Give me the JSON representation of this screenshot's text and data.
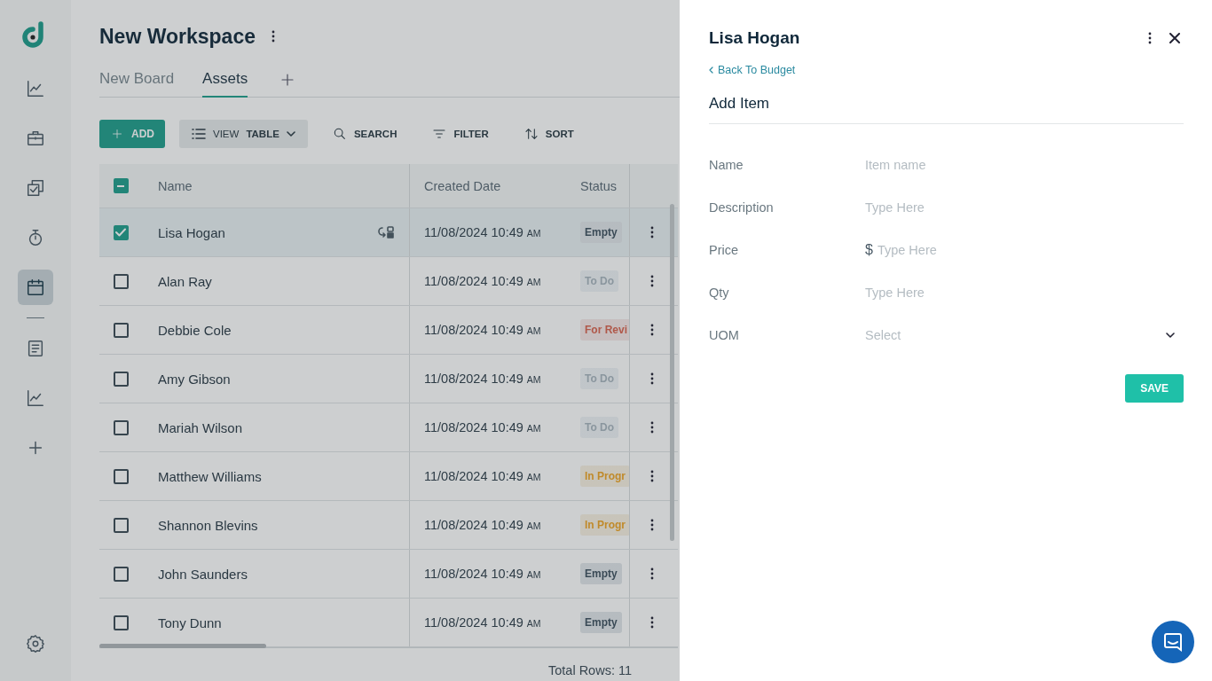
{
  "sidebar": {
    "items": [
      {
        "kind": "chart",
        "selected": false
      },
      {
        "kind": "briefcase",
        "selected": false
      },
      {
        "kind": "tasks",
        "selected": false
      },
      {
        "kind": "timer",
        "selected": false
      },
      {
        "kind": "calendar",
        "selected": true
      },
      {
        "kind": "divider"
      },
      {
        "kind": "document",
        "selected": false
      },
      {
        "kind": "chart",
        "selected": false
      },
      {
        "kind": "plus",
        "selected": false
      }
    ]
  },
  "workspace": {
    "title": "New Workspace"
  },
  "tabs": [
    {
      "label": "New Board",
      "selected": false
    },
    {
      "label": "Assets",
      "selected": true
    }
  ],
  "toolbar": {
    "add": "ADD",
    "view_prefix": "VIEW",
    "view_value": "TABLE",
    "search": "SEARCH",
    "filter": "FILTER",
    "sort": "SORT"
  },
  "table": {
    "header_checkbox": {
      "indeterminate": true
    },
    "columns": [
      "Name",
      "Created Date",
      "Status"
    ],
    "rows": [
      {
        "name": "Lisa Hogan",
        "date": "11/08/2024 10:49",
        "meridiem": "AM",
        "status": "Empty",
        "color": "#3a4a56",
        "selected": true,
        "has_subitems": true
      },
      {
        "name": "Alan Ray",
        "date": "11/08/2024 10:49",
        "meridiem": "AM",
        "status": "To Do",
        "color": "#8a969e",
        "selected": false,
        "has_subitems": false
      },
      {
        "name": "Debbie Cole",
        "date": "11/08/2024 10:49",
        "meridiem": "AM",
        "status": "For Revi",
        "color": "#b0584a",
        "selected": false,
        "has_subitems": false
      },
      {
        "name": "Amy Gibson",
        "date": "11/08/2024 10:49",
        "meridiem": "AM",
        "status": "To Do",
        "color": "#8a969e",
        "selected": false,
        "has_subitems": false
      },
      {
        "name": "Mariah Wilson",
        "date": "11/08/2024 10:49",
        "meridiem": "AM",
        "status": "To Do",
        "color": "#8a969e",
        "selected": false,
        "has_subitems": false
      },
      {
        "name": "Matthew Williams",
        "date": "11/08/2024 10:49",
        "meridiem": "AM",
        "status": "In Progr",
        "color": "#c08a2a",
        "selected": false,
        "has_subitems": false
      },
      {
        "name": "Shannon Blevins",
        "date": "11/08/2024 10:49",
        "meridiem": "AM",
        "status": "In Progr",
        "color": "#c08a2a",
        "selected": false,
        "has_subitems": false
      },
      {
        "name": "John Saunders",
        "date": "11/08/2024 10:49",
        "meridiem": "AM",
        "status": "Empty",
        "color": "#3a4a56",
        "selected": false,
        "has_subitems": false
      },
      {
        "name": "Tony Dunn",
        "date": "11/08/2024 10:49",
        "meridiem": "AM",
        "status": "Empty",
        "color": "#3a4a56",
        "selected": false,
        "has_subitems": false
      }
    ],
    "total": "Total Rows: 11"
  },
  "panel": {
    "title": "Lisa Hogan",
    "back_link": "Back To Budget",
    "heading": "Add Item",
    "fields": [
      {
        "label": "Name",
        "placeholder": "Item name",
        "kind": "text"
      },
      {
        "label": "Description",
        "placeholder": "Type Here",
        "kind": "text"
      },
      {
        "label": "Price",
        "prefix": "$",
        "placeholder": "Type Here",
        "kind": "currency"
      },
      {
        "label": "Qty",
        "placeholder": "Type Here",
        "kind": "text"
      },
      {
        "label": "UOM",
        "placeholder": "Select",
        "kind": "select"
      }
    ],
    "save": "SAVE"
  }
}
